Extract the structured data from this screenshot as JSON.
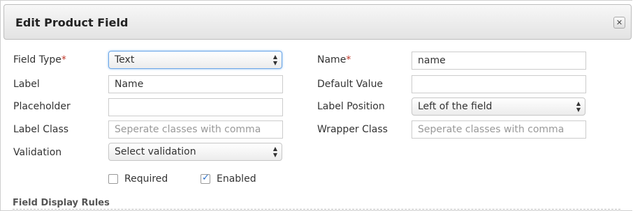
{
  "dialog": {
    "title": "Edit Product Field",
    "close_icon": "close-icon"
  },
  "form": {
    "field_type": {
      "label": "Field Type",
      "required_marker": "*",
      "value": "Text"
    },
    "label": {
      "label": "Label",
      "value": "Name"
    },
    "placeholder": {
      "label": "Placeholder",
      "value": ""
    },
    "label_class": {
      "label": "Label Class",
      "placeholder": "Seperate classes with comma"
    },
    "validation": {
      "label": "Validation",
      "value": "Select validation"
    },
    "name": {
      "label": "Name",
      "required_marker": "*",
      "value": "name"
    },
    "default_value": {
      "label": "Default Value",
      "value": ""
    },
    "label_position": {
      "label": "Label Position",
      "value": "Left of the field"
    },
    "wrapper_class": {
      "label": "Wrapper Class",
      "placeholder": "Seperate classes with comma"
    },
    "required_checkbox": {
      "label": "Required",
      "checked": false
    },
    "enabled_checkbox": {
      "label": "Enabled",
      "checked": true
    }
  },
  "section": {
    "title": "Field Display Rules"
  }
}
